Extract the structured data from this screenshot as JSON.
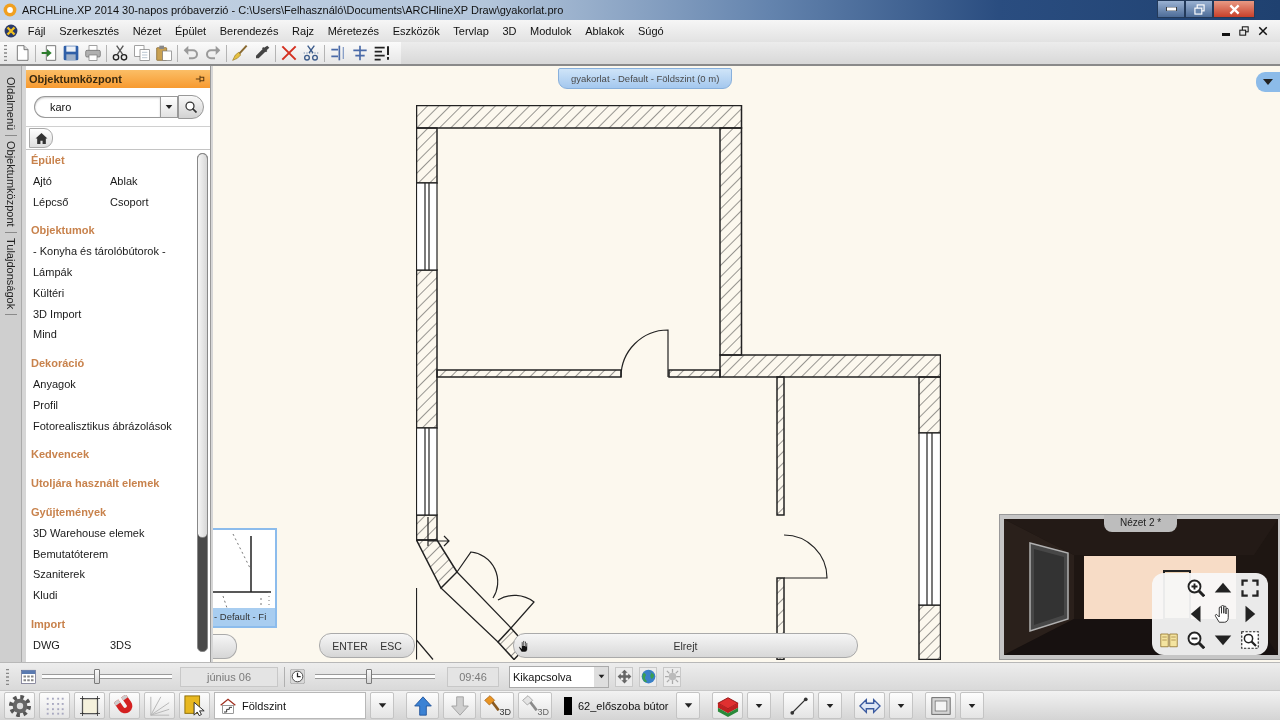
{
  "window": {
    "title": "ARCHLine.XP 2014 30-napos próbaverzió - C:\\Users\\Felhasználó\\Documents\\ARCHlineXP Draw\\gyakorlat.pro"
  },
  "menu": [
    "Fájl",
    "Szerkesztés",
    "Nézet",
    "Épület",
    "Berendezés",
    "Rajz",
    "Méretezés",
    "Eszközök",
    "Tervlap",
    "3D",
    "Modulok",
    "Ablakok",
    "Súgó"
  ],
  "side_tabs": [
    "Oldalmenü",
    "Objektumközpont",
    "Tulajdonságok"
  ],
  "object_center": {
    "title": "Objektumközpont",
    "search": {
      "value": "karo"
    },
    "sections": [
      {
        "title": "Épület",
        "kind": "grid",
        "items": [
          "Ajtó",
          "Ablak",
          "Lépcső",
          "Csoport"
        ]
      },
      {
        "title": "Objektumok",
        "kind": "list",
        "items": [
          "- Konyha és tárolóbútorok -",
          "Lámpák",
          "Kültéri",
          "3D Import",
          "Mind"
        ]
      },
      {
        "title": "Dekoráció",
        "kind": "list",
        "items": [
          "Anyagok",
          "Profil",
          "Fotorealisztikus ábrázolások"
        ]
      },
      {
        "title": "Kedvencek",
        "kind": "list"
      },
      {
        "title": "Utoljára használt elemek",
        "kind": "list"
      },
      {
        "title": "Gyűjtemények",
        "kind": "list",
        "items": [
          "3D Warehouse elemek",
          "Bemutatóterem",
          "Szaniterek",
          "Kludi"
        ]
      },
      {
        "title": "Import",
        "kind": "grid",
        "items": [
          "DWG",
          "3DS"
        ]
      }
    ]
  },
  "canvas": {
    "view_tab": "gyakorlat - Default - Földszint (0 m)",
    "thumbnail_label": "- Default - Fi",
    "command_buttons": [
      "ENTER",
      "ESC"
    ],
    "hide_button": "Elrejt",
    "view_3d_title": "Nézet 2 *"
  },
  "time_bar": {
    "date_slider": {
      "level": 0.42
    },
    "date": "június 06",
    "time_slider": {
      "level": 0.45
    },
    "time": "09:46",
    "shadow": "Kikapcsolva"
  },
  "bottom_toolbar": {
    "floor": "Földszint",
    "floor_buttons": [
      {
        "kind": "up",
        "disabled": false
      },
      {
        "kind": "down",
        "disabled": true
      }
    ],
    "tools_3d": [
      {
        "label": "3D",
        "disabled": false
      },
      {
        "label": "3D",
        "disabled": true
      }
    ],
    "layer": "62_előszoba bútor"
  }
}
